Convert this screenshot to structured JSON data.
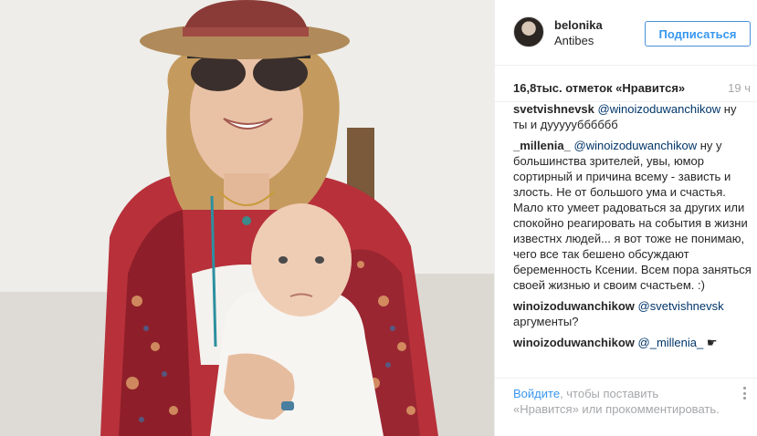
{
  "post": {
    "username": "belonika",
    "location": "Antibes",
    "follow_label": "Подписаться",
    "likes": "16,8тыс. отметок «Нравится»",
    "time": "19 ч"
  },
  "comments": [
    {
      "user": "svetvishnevsk",
      "mention": "@winoizoduwanchikow",
      "text": "ну ты и дууууубббббб"
    },
    {
      "user": "_millenia_",
      "mention": "@winoizoduwanchikow",
      "text": "ну у большинства зрителей, увы, юмор сортирный и причина всему - зависть и злость. Не от большого ума и счастья. Мало кто умеет радоваться за других или спокойно реагировать на события в жизни известнх людей... я вот тоже не понимаю, чего все так бешено обсуждают беременность Ксении. Всем пора заняться своей жизнью и своим счастьем. :)"
    },
    {
      "user": "winoizoduwanchikow",
      "mention": "@svetvishnevsk",
      "text": "аргументы?"
    },
    {
      "user": "winoizoduwanchikow",
      "mention": "@_millenia_",
      "text": "☛"
    }
  ],
  "footer": {
    "login_link": "Войдите",
    "login_text": ", чтобы поставить «Нравится» или прокомментировать."
  },
  "colors": {
    "accent": "#3897f0",
    "mention": "#003569",
    "muted": "#a5a7aa"
  }
}
